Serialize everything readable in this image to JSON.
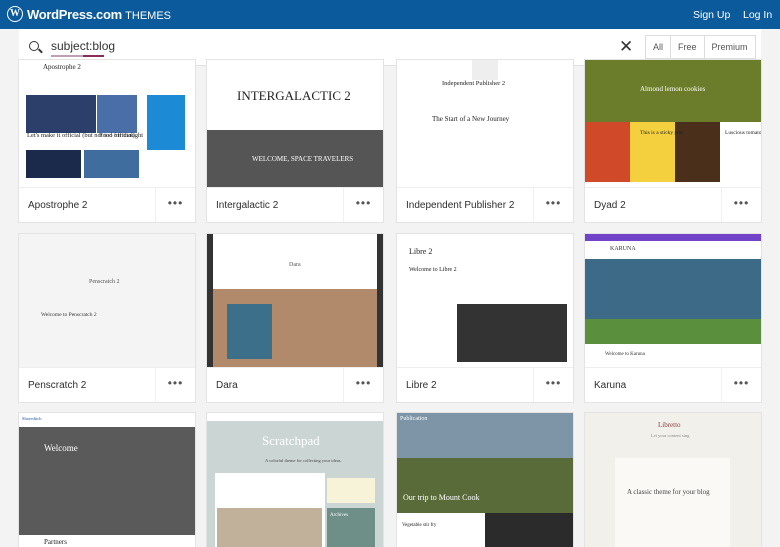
{
  "header": {
    "brand": "WordPress.com",
    "section": "THEMES",
    "sign_up": "Sign Up",
    "log_in": "Log In"
  },
  "search": {
    "value": "subject:blog",
    "icon": "search-icon",
    "clear_icon": "close-icon"
  },
  "filters": [
    "All",
    "Free",
    "Premium"
  ],
  "themes": [
    {
      "name": "Apostrophe 2",
      "more": "•••",
      "thumb": {
        "title": "Apostrophe 2",
        "headline": "Let's make it official (but not too official)",
        "side": "Food for thought"
      }
    },
    {
      "name": "Intergalactic 2",
      "more": "•••",
      "thumb": {
        "title": "INTERGALACTIC 2",
        "headline": "WELCOME, SPACE TRAVELERS"
      }
    },
    {
      "name": "Independent Publisher 2",
      "more": "•••",
      "thumb": {
        "title": "Independent Publisher 2",
        "headline": "The Start of a New Journey"
      }
    },
    {
      "name": "Dyad 2",
      "more": "•••",
      "thumb": {
        "title": "Almond lemon cookies",
        "headline": "This is a sticky post",
        "side": "Luscious tomato salsa"
      }
    },
    {
      "name": "Penscratch 2",
      "more": "•••",
      "thumb": {
        "title": "Penscratch 2",
        "headline": "Welcome to Penscratch 2"
      }
    },
    {
      "name": "Dara",
      "more": "•••",
      "thumb": {
        "title": "Dara"
      }
    },
    {
      "name": "Libre 2",
      "more": "•••",
      "thumb": {
        "title": "Libre 2",
        "headline": "Welcome to Libre 2"
      }
    },
    {
      "name": "Karuna",
      "more": "•••",
      "thumb": {
        "title": "KARUNA",
        "headline": "Welcome to Karuna"
      }
    },
    {
      "name": "Shoreditch",
      "more": "•••",
      "thumb": {
        "title": "Shoreditch",
        "headline": "Welcome",
        "side": "Partners"
      }
    },
    {
      "name": "Scratchpad",
      "more": "•••",
      "thumb": {
        "title": "Scratchpad",
        "headline": "A colorful theme for collecting your ideas.",
        "side": "Archives"
      }
    },
    {
      "name": "Publication",
      "more": "•••",
      "thumb": {
        "title": "Publication",
        "headline": "Our trip to Mount Cook",
        "side": "Vegetable stir fry"
      }
    },
    {
      "name": "Libretto",
      "more": "•••",
      "thumb": {
        "title": "Libretto",
        "headline": "A classic theme for your blog",
        "side": "Let your content sing"
      }
    }
  ]
}
